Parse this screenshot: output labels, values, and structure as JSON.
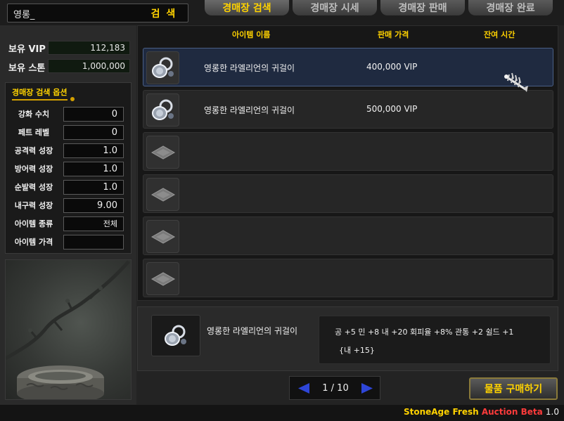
{
  "search": {
    "value": "영롱_",
    "button_label": "검 색"
  },
  "tabs": [
    {
      "label": "경매장 검색",
      "active": true
    },
    {
      "label": "경매장 시세",
      "active": false
    },
    {
      "label": "경매장 판매",
      "active": false
    },
    {
      "label": "경매장 완료",
      "active": false
    }
  ],
  "balances": [
    {
      "label": "보유 VIP",
      "value": "112,183"
    },
    {
      "label": "보유 스톤",
      "value": "1,000,000"
    }
  ],
  "options": {
    "title": "경매장 검색 옵션",
    "fields": [
      {
        "label": "강화 수치",
        "value": "0"
      },
      {
        "label": "페트 레벨",
        "value": "0"
      },
      {
        "label": "공격력 성장",
        "value": "1.0"
      },
      {
        "label": "방어력 성장",
        "value": "1.0"
      },
      {
        "label": "순발력 성장",
        "value": "1.0"
      },
      {
        "label": "내구력 성장",
        "value": "9.00"
      },
      {
        "label": "아이템 종류",
        "value": "전체"
      },
      {
        "label": "아이템 가격",
        "value": ""
      }
    ]
  },
  "list": {
    "columns": [
      "아이템 이름",
      "판매 가격",
      "잔여 시간"
    ],
    "rows": [
      {
        "name": "영롱한 라엘리언의 귀걸이",
        "price": "400,000  VIP",
        "icon": "earring-icon",
        "selected": true
      },
      {
        "name": "영롱한 라엘리언의 귀걸이",
        "price": "500,000  VIP",
        "icon": "earring-icon",
        "selected": false
      },
      {
        "name": "",
        "price": "",
        "icon": "empty-slot-icon",
        "selected": false
      },
      {
        "name": "",
        "price": "",
        "icon": "empty-slot-icon",
        "selected": false
      },
      {
        "name": "",
        "price": "",
        "icon": "empty-slot-icon",
        "selected": false
      },
      {
        "name": "",
        "price": "",
        "icon": "empty-slot-icon",
        "selected": false
      }
    ]
  },
  "detail": {
    "name": "영롱한 라엘리언의 귀걸이",
    "stats_line1": "공 +5 민 +8 내 +20 회피율 +8% 관통 +2 쉴드 +1",
    "stats_line2": "{내 +15}",
    "icon": "earring-icon"
  },
  "pagination": {
    "text": "1 / 10"
  },
  "buy_button": {
    "label": "물품 구매하기"
  },
  "footer": {
    "game": "StoneAge Fresh",
    "auction": "Auction Beta",
    "version": "1.0"
  },
  "colors": {
    "accent": "#ffd200",
    "selected_row": "#1f2a40",
    "auction_red": "#ff3b3b",
    "arrow_blue": "#2e46d8"
  },
  "icons": [
    "earring-icon",
    "empty-slot-icon",
    "fish-bone-cursor-icon",
    "prev-page-icon",
    "next-page-icon"
  ]
}
